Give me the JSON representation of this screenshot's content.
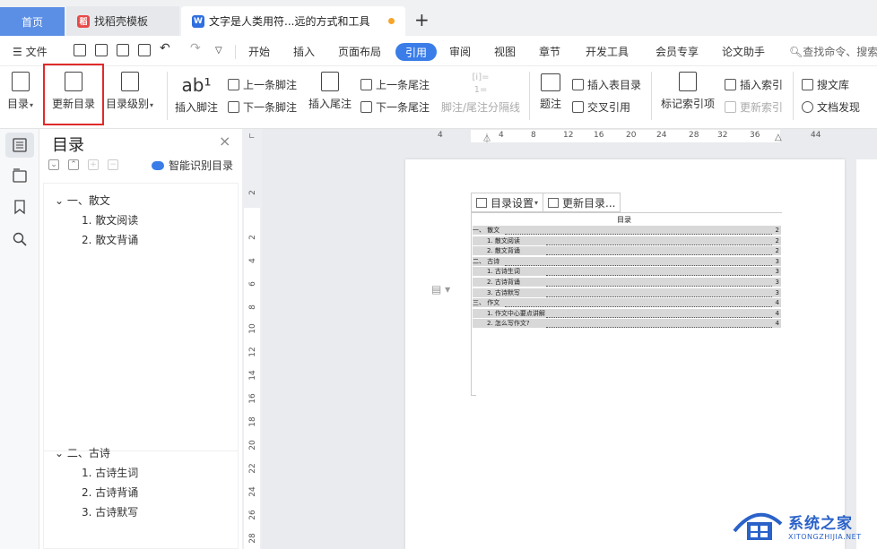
{
  "tabs": {
    "home": "首页",
    "template": "找稻壳模板",
    "document": "文字是人类用符...远的方式和工具",
    "add": "+"
  },
  "menu": {
    "file": "文件",
    "items": [
      "开始",
      "插入",
      "页面布局",
      "引用",
      "审阅",
      "视图",
      "章节",
      "开发工具",
      "会员专享",
      "论文助手"
    ],
    "active": "引用",
    "search": "查找命令、搜索"
  },
  "ribbon": {
    "toc": "目录",
    "update_toc": "更新目录",
    "toc_level": "目录级别",
    "insert_footnote": "插入脚注",
    "prev_footnote": "上一条脚注",
    "next_footnote": "下一条脚注",
    "insert_endnote": "插入尾注",
    "prev_endnote": "上一条尾注",
    "next_endnote": "下一条尾注",
    "separator_line": "脚注/尾注分隔线",
    "caption": "题注",
    "insert_table_toc": "插入表目录",
    "cross_ref": "交叉引用",
    "mark_index": "标记索引项",
    "insert_index": "插入索引",
    "update_index": "更新索引",
    "search_library": "搜文库",
    "doc_discover": "文档发现"
  },
  "toc_panel": {
    "title": "目录",
    "close": "×",
    "smart_button": "智能识别目录",
    "entries_top": [
      {
        "label": "一、散文",
        "level": 1
      },
      {
        "label": "1. 散文阅读",
        "level": 2
      },
      {
        "label": "2. 散文背诵",
        "level": 2
      }
    ],
    "entries_bottom": [
      {
        "label": "二、古诗",
        "level": 1
      },
      {
        "label": "1. 古诗生词",
        "level": 2
      },
      {
        "label": "2. 古诗背诵",
        "level": 2
      },
      {
        "label": "3. 古诗默写",
        "level": 2
      }
    ]
  },
  "ruler": {
    "h_ticks": [
      "4",
      "4",
      "8",
      "12",
      "16",
      "20",
      "24",
      "28",
      "32",
      "36",
      "44"
    ],
    "v_ticks": [
      "2",
      "2",
      "4",
      "6",
      "8",
      "10",
      "12",
      "14",
      "16",
      "18",
      "20",
      "22",
      "24",
      "26",
      "28"
    ]
  },
  "document": {
    "toc_settings": "目录设置",
    "update_toc": "更新目录...",
    "toc_heading": "目录",
    "lines": [
      {
        "text": "一、 散文",
        "page": "2",
        "indent": 0
      },
      {
        "text": "1. 散文阅读",
        "page": "2",
        "indent": 1
      },
      {
        "text": "2. 散文背诵",
        "page": "2",
        "indent": 1
      },
      {
        "text": "二、 古诗",
        "page": "3",
        "indent": 0
      },
      {
        "text": "1. 古诗生词",
        "page": "3",
        "indent": 1
      },
      {
        "text": "2. 古诗背诵",
        "page": "3",
        "indent": 1
      },
      {
        "text": "3. 古诗默写",
        "page": "3",
        "indent": 1
      },
      {
        "text": "三、 作文",
        "page": "4",
        "indent": 0
      },
      {
        "text": "1. 作文中心要点讲解",
        "page": "4",
        "indent": 1
      },
      {
        "text": "2. 怎么写作文?",
        "page": "4",
        "indent": 1
      }
    ]
  },
  "watermark": {
    "cn": "系统之家",
    "en": "XITONGZHIJIA.NET"
  },
  "colors": {
    "accent": "#3a7de8",
    "highlight": "#e02a2a",
    "home_tab": "#5b8fe6"
  }
}
